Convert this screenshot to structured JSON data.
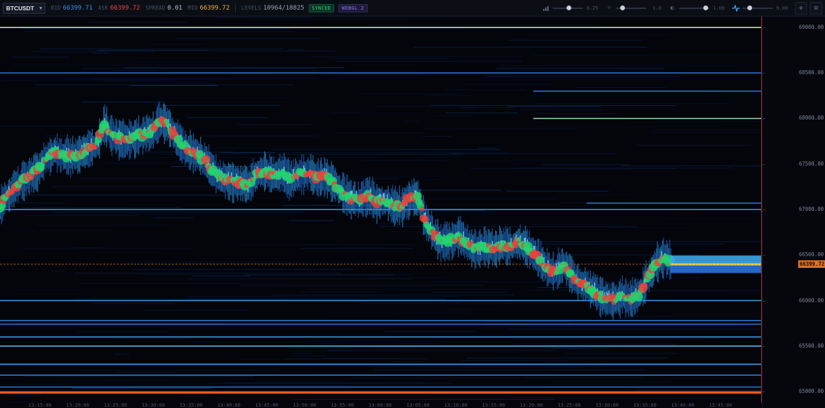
{
  "toolbar": {
    "symbol": "BTCUSDT",
    "bid_label": "BID",
    "bid_value": "66399.71",
    "ask_label": "ASK",
    "ask_value": "66399.72",
    "spread_label": "SPREAD",
    "spread_value": "0.01",
    "mid_label": "MID",
    "mid_value": "66399.72",
    "levels_label": "LEVELS",
    "levels_value": "10964/18825",
    "synced_badge": "SYNCED",
    "webgl_badge": "WEBGL 2",
    "controls": [
      {
        "icon": "brightness-small-icon",
        "value": "0.25",
        "level": 0.55
      },
      {
        "icon": "sun-icon",
        "value": "1.0",
        "level": 0.15
      },
      {
        "icon": "contrast-icon",
        "value": "1.00",
        "level": 0.95
      },
      {
        "icon": "pulse-icon",
        "value": "0.00",
        "level": 0.2
      }
    ]
  },
  "chart_data": {
    "type": "heatmap",
    "ylim": [
      64880,
      69120
    ],
    "y_ticks": [
      "69000.00",
      "68500.00",
      "68000.00",
      "67500.00",
      "67000.00",
      "66500.00",
      "66000.00",
      "65500.00",
      "65000.00"
    ],
    "x_ticks": [
      "13:15:00",
      "13:20:00",
      "13:25:00",
      "13:30:00",
      "13:35:00",
      "13:40:00",
      "13:45:00",
      "13:50:00",
      "13:55:00",
      "13:00:00",
      "13:05:00",
      "13:10:00",
      "13:15:00",
      "13:20:00",
      "13:25:00",
      "13:30:00",
      "13:35:00",
      "13:40:00",
      "13:45:00"
    ],
    "current_price": "66399.72",
    "price_path": [
      [
        0,
        67040
      ],
      [
        8,
        67130
      ],
      [
        18,
        67220
      ],
      [
        30,
        67300
      ],
      [
        42,
        67380
      ],
      [
        55,
        67430
      ],
      [
        65,
        67550
      ],
      [
        78,
        67640
      ],
      [
        90,
        67600
      ],
      [
        105,
        67580
      ],
      [
        118,
        67620
      ],
      [
        130,
        67680
      ],
      [
        142,
        67720
      ],
      [
        150,
        67930
      ],
      [
        160,
        67830
      ],
      [
        172,
        67780
      ],
      [
        185,
        67760
      ],
      [
        198,
        67800
      ],
      [
        212,
        67840
      ],
      [
        222,
        67860
      ],
      [
        232,
        67980
      ],
      [
        242,
        67940
      ],
      [
        252,
        67840
      ],
      [
        262,
        67730
      ],
      [
        275,
        67640
      ],
      [
        288,
        67600
      ],
      [
        300,
        67520
      ],
      [
        315,
        67370
      ],
      [
        330,
        67320
      ],
      [
        345,
        67300
      ],
      [
        360,
        67270
      ],
      [
        372,
        67380
      ],
      [
        385,
        67410
      ],
      [
        398,
        67380
      ],
      [
        410,
        67400
      ],
      [
        422,
        67330
      ],
      [
        435,
        67390
      ],
      [
        448,
        67410
      ],
      [
        460,
        67340
      ],
      [
        472,
        67360
      ],
      [
        485,
        67290
      ],
      [
        498,
        67180
      ],
      [
        510,
        67120
      ],
      [
        522,
        67100
      ],
      [
        535,
        67150
      ],
      [
        548,
        67080
      ],
      [
        560,
        67090
      ],
      [
        572,
        67040
      ],
      [
        585,
        67040
      ],
      [
        598,
        67150
      ],
      [
        608,
        67130
      ],
      [
        618,
        66880
      ],
      [
        630,
        66720
      ],
      [
        642,
        66640
      ],
      [
        655,
        66660
      ],
      [
        668,
        66710
      ],
      [
        680,
        66610
      ],
      [
        692,
        66560
      ],
      [
        705,
        66600
      ],
      [
        718,
        66570
      ],
      [
        730,
        66610
      ],
      [
        742,
        66590
      ],
      [
        755,
        66650
      ],
      [
        768,
        66570
      ],
      [
        780,
        66480
      ],
      [
        792,
        66380
      ],
      [
        805,
        66300
      ],
      [
        818,
        66390
      ],
      [
        830,
        66300
      ],
      [
        842,
        66200
      ],
      [
        855,
        66150
      ],
      [
        868,
        66080
      ],
      [
        880,
        66020
      ],
      [
        892,
        66000
      ],
      [
        905,
        66050
      ],
      [
        918,
        66010
      ],
      [
        930,
        66080
      ],
      [
        942,
        66260
      ],
      [
        955,
        66410
      ],
      [
        965,
        66480
      ],
      [
        975,
        66420
      ]
    ],
    "bid_levels": [
      66399.71,
      66380,
      66360,
      66340,
      66320
    ],
    "ask_levels": [
      66399.72,
      66420,
      66440,
      66460,
      66480
    ],
    "liquidity_lines": [
      {
        "price": 69000,
        "color": "#c8e8a0",
        "from": 0.0
      },
      {
        "price": 68500,
        "color": "#2a6fd8",
        "from": 0.0
      },
      {
        "price": 68300,
        "color": "#2a6fd8",
        "from": 0.7
      },
      {
        "price": 68000,
        "color": "#9ce0b0",
        "from": 0.7
      },
      {
        "price": 67070,
        "color": "#2a6fd8",
        "from": 0.77
      },
      {
        "price": 67000,
        "color": "#3aa0e8",
        "from": 0.0
      },
      {
        "price": 66000,
        "color": "#3aa0e8",
        "from": 0.0
      },
      {
        "price": 65780,
        "color": "#2b7ad8",
        "from": 0.0
      },
      {
        "price": 65740,
        "color": "#2b7ad8",
        "from": 0.0
      },
      {
        "price": 65600,
        "color": "#3aa0e8",
        "from": 0.0
      },
      {
        "price": 65500,
        "color": "#4bb8f0",
        "from": 0.0
      },
      {
        "price": 65300,
        "color": "#3aa0e8",
        "from": 0.0
      },
      {
        "price": 65180,
        "color": "#2b7ad8",
        "from": 0.0
      },
      {
        "price": 65050,
        "color": "#2b7ad8",
        "from": 0.0
      },
      {
        "price": 64990,
        "color": "#f05a1e",
        "from": 0.0
      }
    ]
  }
}
